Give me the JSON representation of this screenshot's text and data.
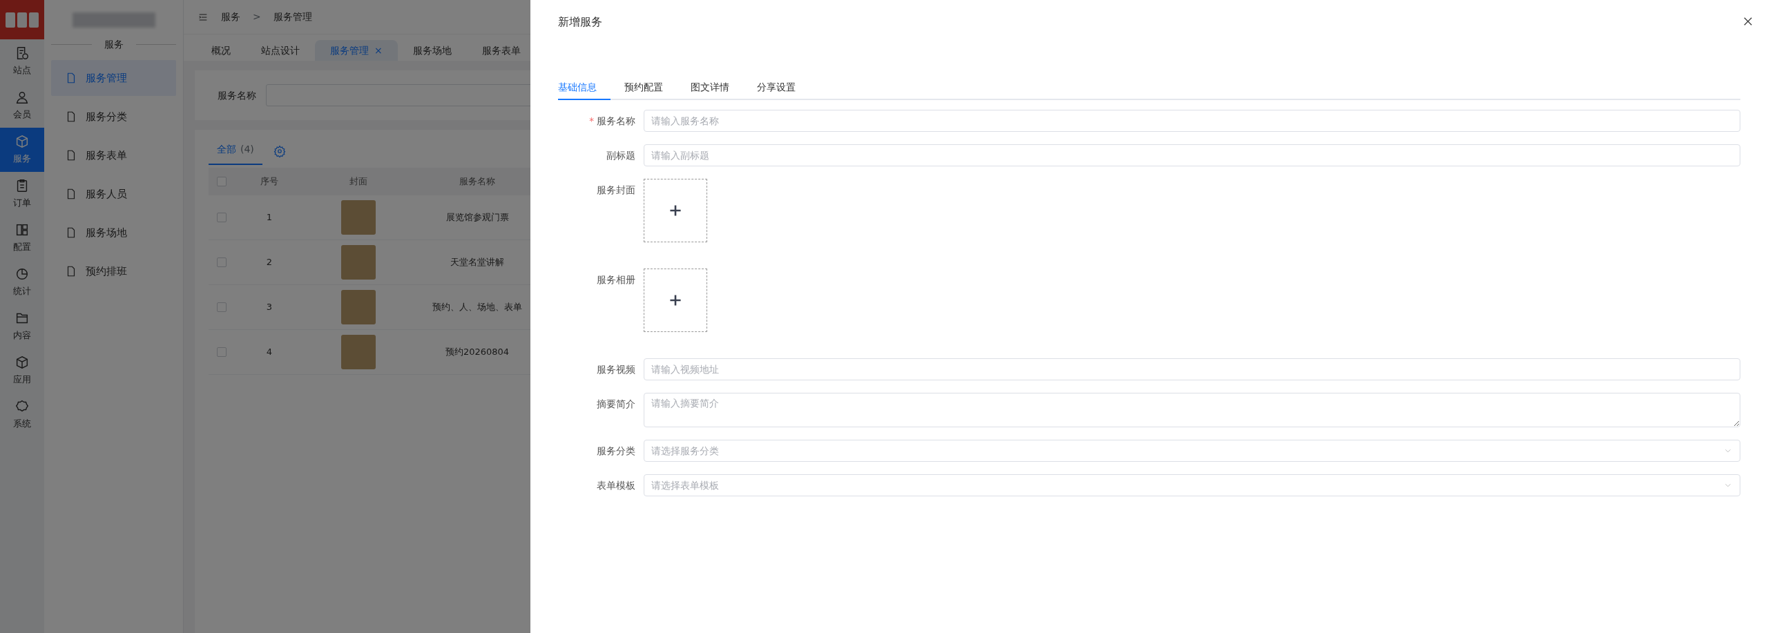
{
  "rail": {
    "items": [
      {
        "label": "站点",
        "selected": false
      },
      {
        "label": "会员",
        "selected": false
      },
      {
        "label": "服务",
        "selected": true
      },
      {
        "label": "订单",
        "selected": false
      },
      {
        "label": "配置",
        "selected": false
      },
      {
        "label": "统计",
        "selected": false
      },
      {
        "label": "内容",
        "selected": false
      },
      {
        "label": "应用",
        "selected": false
      },
      {
        "label": "系统",
        "selected": false
      }
    ]
  },
  "sidebar": {
    "title": "服务",
    "items": [
      {
        "label": "服务管理",
        "selected": true
      },
      {
        "label": "服务分类",
        "selected": false
      },
      {
        "label": "服务表单",
        "selected": false
      },
      {
        "label": "服务人员",
        "selected": false
      },
      {
        "label": "服务场地",
        "selected": false
      },
      {
        "label": "预约排班",
        "selected": false
      }
    ]
  },
  "breadcrumb": {
    "items": [
      "服务",
      "服务管理"
    ],
    "separator": ">"
  },
  "page_tabs": [
    {
      "label": "概况",
      "selected": false
    },
    {
      "label": "站点设计",
      "selected": false
    },
    {
      "label": "服务管理",
      "selected": true,
      "close": "×"
    },
    {
      "label": "服务场地",
      "selected": false
    },
    {
      "label": "服务表单",
      "selected": false
    }
  ],
  "search": {
    "label": "服务名称"
  },
  "list_tabs": [
    {
      "label": "全部",
      "count": "(4)",
      "selected": true
    }
  ],
  "table": {
    "header_checked": false,
    "columns": [
      "序号",
      "封面",
      "服务名称"
    ],
    "rows": [
      {
        "checked": false,
        "index": "1",
        "name": "展览馆参观门票"
      },
      {
        "checked": false,
        "index": "2",
        "name": "天堂名堂讲解"
      },
      {
        "checked": false,
        "index": "3",
        "name": "预约、人、场地、表单"
      },
      {
        "checked": false,
        "index": "4",
        "name": "预约20260804"
      }
    ]
  },
  "drawer": {
    "title": "新增服务",
    "tabs": [
      {
        "label": "基础信息",
        "selected": true
      },
      {
        "label": "预约配置",
        "selected": false
      },
      {
        "label": "图文详情",
        "selected": false
      },
      {
        "label": "分享设置",
        "selected": false
      }
    ],
    "fields": [
      {
        "kind": "input",
        "label": "服务名称",
        "required_mark": "*",
        "placeholder": "请输入服务名称"
      },
      {
        "kind": "input",
        "label": "副标题",
        "placeholder": "请输入副标题"
      },
      {
        "kind": "upload",
        "label": "服务封面"
      },
      {
        "kind": "upload",
        "label": "服务相册"
      },
      {
        "kind": "input",
        "label": "服务视频",
        "placeholder": "请输入视频地址"
      },
      {
        "kind": "textarea",
        "label": "摘要简介",
        "placeholder": "请输入摘要简介"
      },
      {
        "kind": "select",
        "label": "服务分类",
        "placeholder": "请选择服务分类"
      },
      {
        "kind": "select",
        "label": "表单模板",
        "placeholder": "请选择表单模板"
      }
    ]
  }
}
